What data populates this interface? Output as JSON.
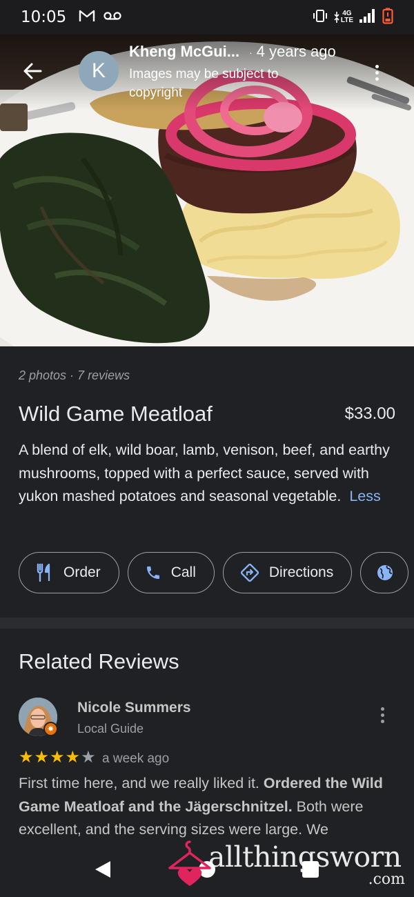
{
  "status_bar": {
    "time": "10:05",
    "left_icons": [
      "gmail-icon",
      "voicemail-icon"
    ],
    "right_icons": [
      "vibrate-icon",
      "4g-lte-icon",
      "signal-icon",
      "battery-low-icon"
    ],
    "network_top": "4G",
    "network_bottom": "LTE",
    "battery_color": "#ff5a36"
  },
  "photo_header": {
    "avatar_letter": "K",
    "author": "Kheng McGui...",
    "separator": "·",
    "time_ago": "4 years ago",
    "copyright_note": "Images may be subject to copyright"
  },
  "item": {
    "meta": "2 photos · 7 reviews",
    "name": "Wild Game Meatloaf",
    "price": "$33.00",
    "description": "A blend of elk, wild boar, lamb, venison, beef, and earthy mushrooms, topped with a perfect sauce, served with yukon mashed potatoes and seasonal vegetable.",
    "less_link": "Less"
  },
  "actions": [
    {
      "label": "Order",
      "icon": "restaurant-icon"
    },
    {
      "label": "Call",
      "icon": "phone-icon"
    },
    {
      "label": "Directions",
      "icon": "directions-icon"
    },
    {
      "label": "",
      "icon": "globe-icon"
    }
  ],
  "reviews": {
    "heading": "Related Reviews",
    "review": {
      "name": "Nicole Summers",
      "subtitle": "Local Guide",
      "rating": 4,
      "max_rating": 5,
      "time": "a week ago",
      "text_part1": "First time here, and we really liked it. ",
      "text_bold": "Ordered the Wild Game Meatloaf and the Jägerschnitzel.",
      "text_part2": " Both were excellent, and the serving sizes were large. We"
    }
  },
  "watermark": {
    "text": "allthingsworn",
    "suffix": ".com"
  },
  "colors": {
    "background": "#202124",
    "accent_link": "#8ab4f8",
    "star": "#fbbc04",
    "badge": "#e8710a"
  }
}
